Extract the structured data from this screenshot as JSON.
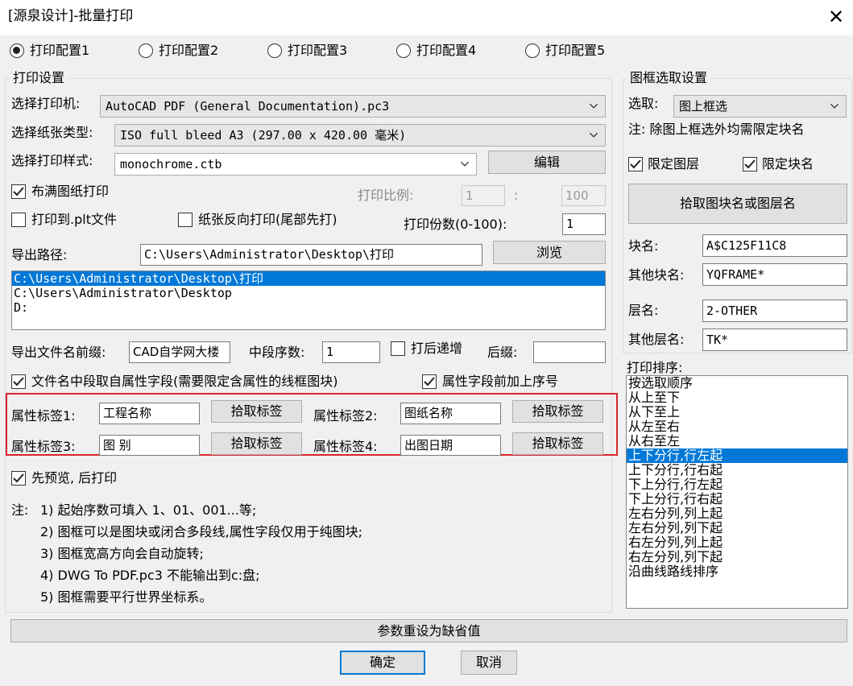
{
  "window": {
    "title": "[源泉设计]-批量打印",
    "close_glyph": "✕"
  },
  "configs": [
    {
      "label": "打印配置1",
      "selected": true
    },
    {
      "label": "打印配置2",
      "selected": false
    },
    {
      "label": "打印配置3",
      "selected": false
    },
    {
      "label": "打印配置4",
      "selected": false
    },
    {
      "label": "打印配置5",
      "selected": false
    }
  ],
  "print_settings": {
    "group_title": "打印设置",
    "printer_label": "选择打印机:",
    "printer_value": "AutoCAD PDF (General Documentation).pc3",
    "paper_label": "选择纸张类型:",
    "paper_value": "ISO full bleed A3 (297.00 x 420.00 毫米)",
    "style_label": "选择打印样式:",
    "style_value": "monochrome.ctb",
    "edit_button": "编辑",
    "fit_paper_label": "布满图纸打印",
    "fit_paper_checked": true,
    "scale_label": "打印比例:",
    "scale_a": "1",
    "scale_sep": ":",
    "scale_b": "100",
    "plt_label": "打印到.plt文件",
    "plt_checked": false,
    "reverse_label": "纸张反向打印(尾部先打)",
    "reverse_checked": false,
    "copies_label": "打印份数(0-100):",
    "copies_value": "1",
    "path_label": "导出路径:",
    "path_value": "C:\\Users\\Administrator\\Desktop\\打印",
    "browse_button": "浏览",
    "path_list": [
      {
        "text": "C:\\Users\\Administrator\\Desktop\\打印",
        "selected": true
      },
      {
        "text": "C:\\Users\\Administrator\\Desktop",
        "selected": false
      },
      {
        "text": "D:",
        "selected": false
      }
    ],
    "prefix_label": "导出文件名前缀:",
    "prefix_value": "CAD自学网大楼",
    "mid_seq_label": "中段序数:",
    "mid_seq_value": "1",
    "increment_label": "打后递增",
    "increment_checked": false,
    "suffix_label": "后缀:",
    "suffix_value": "",
    "mid_from_attr_label": "文件名中段取自属性字段(需要限定含属性的线框图块)",
    "mid_from_attr_checked": true,
    "attr_prefix_seq_label": "属性字段前加上序号",
    "attr_prefix_seq_checked": true,
    "attr_tags": [
      {
        "label": "属性标签1:",
        "value": "工程名称",
        "button": "拾取标签"
      },
      {
        "label": "属性标签2:",
        "value": "图纸名称",
        "button": "拾取标签"
      },
      {
        "label": "属性标签3:",
        "value": "图 别",
        "button": "拾取标签"
      },
      {
        "label": "属性标签4:",
        "value": "出图日期",
        "button": "拾取标签"
      }
    ],
    "preview_label": "先预览, 后打印",
    "preview_checked": true,
    "notes_prefix": "注:",
    "notes": [
      "1) 起始序数可填入 1、01、001...等;",
      "2) 图框可以是图块或闭合多段线,属性字段仅用于纯图块;",
      "3) 图框宽高方向会自动旋转;",
      "4) DWG To PDF.pc3 不能输出到c:盘;",
      "5) 图框需要平行世界坐标系。"
    ]
  },
  "frame_settings": {
    "group_title": "图框选取设置",
    "select_label": "选取:",
    "select_value": "图上框选",
    "note": "注: 除图上框选外均需限定块名",
    "limit_layer_label": "限定图层",
    "limit_layer_checked": true,
    "limit_block_label": "限定块名",
    "limit_block_checked": true,
    "pick_button": "拾取图块名或图层名",
    "block_name_label": "块名:",
    "block_name_value": "A$C125F11C8",
    "other_block_label": "其他块名:",
    "other_block_value": "YQFRAME*",
    "layer_label": "层名:",
    "layer_value": "2-OTHER",
    "other_layer_label": "其他层名:",
    "other_layer_value": "TK*"
  },
  "sort": {
    "label": "打印排序:",
    "items": [
      {
        "text": "按选取顺序",
        "selected": false
      },
      {
        "text": "从上至下",
        "selected": false
      },
      {
        "text": "从下至上",
        "selected": false
      },
      {
        "text": "从左至右",
        "selected": false
      },
      {
        "text": "从右至左",
        "selected": false
      },
      {
        "text": "上下分行,行左起",
        "selected": true
      },
      {
        "text": "上下分行,行右起",
        "selected": false
      },
      {
        "text": "下上分行,行左起",
        "selected": false
      },
      {
        "text": "下上分行,行右起",
        "selected": false
      },
      {
        "text": "左右分列,列上起",
        "selected": false
      },
      {
        "text": "左右分列,列下起",
        "selected": false
      },
      {
        "text": "右左分列,列上起",
        "selected": false
      },
      {
        "text": "右左分列,列下起",
        "selected": false
      },
      {
        "text": "沿曲线路线排序",
        "selected": false
      }
    ]
  },
  "footer": {
    "reset_button": "参数重设为缺省值",
    "ok_button": "确定",
    "cancel_button": "取消"
  },
  "colors": {
    "accent": "#0078d7",
    "highlight_border": "#d9262a"
  }
}
